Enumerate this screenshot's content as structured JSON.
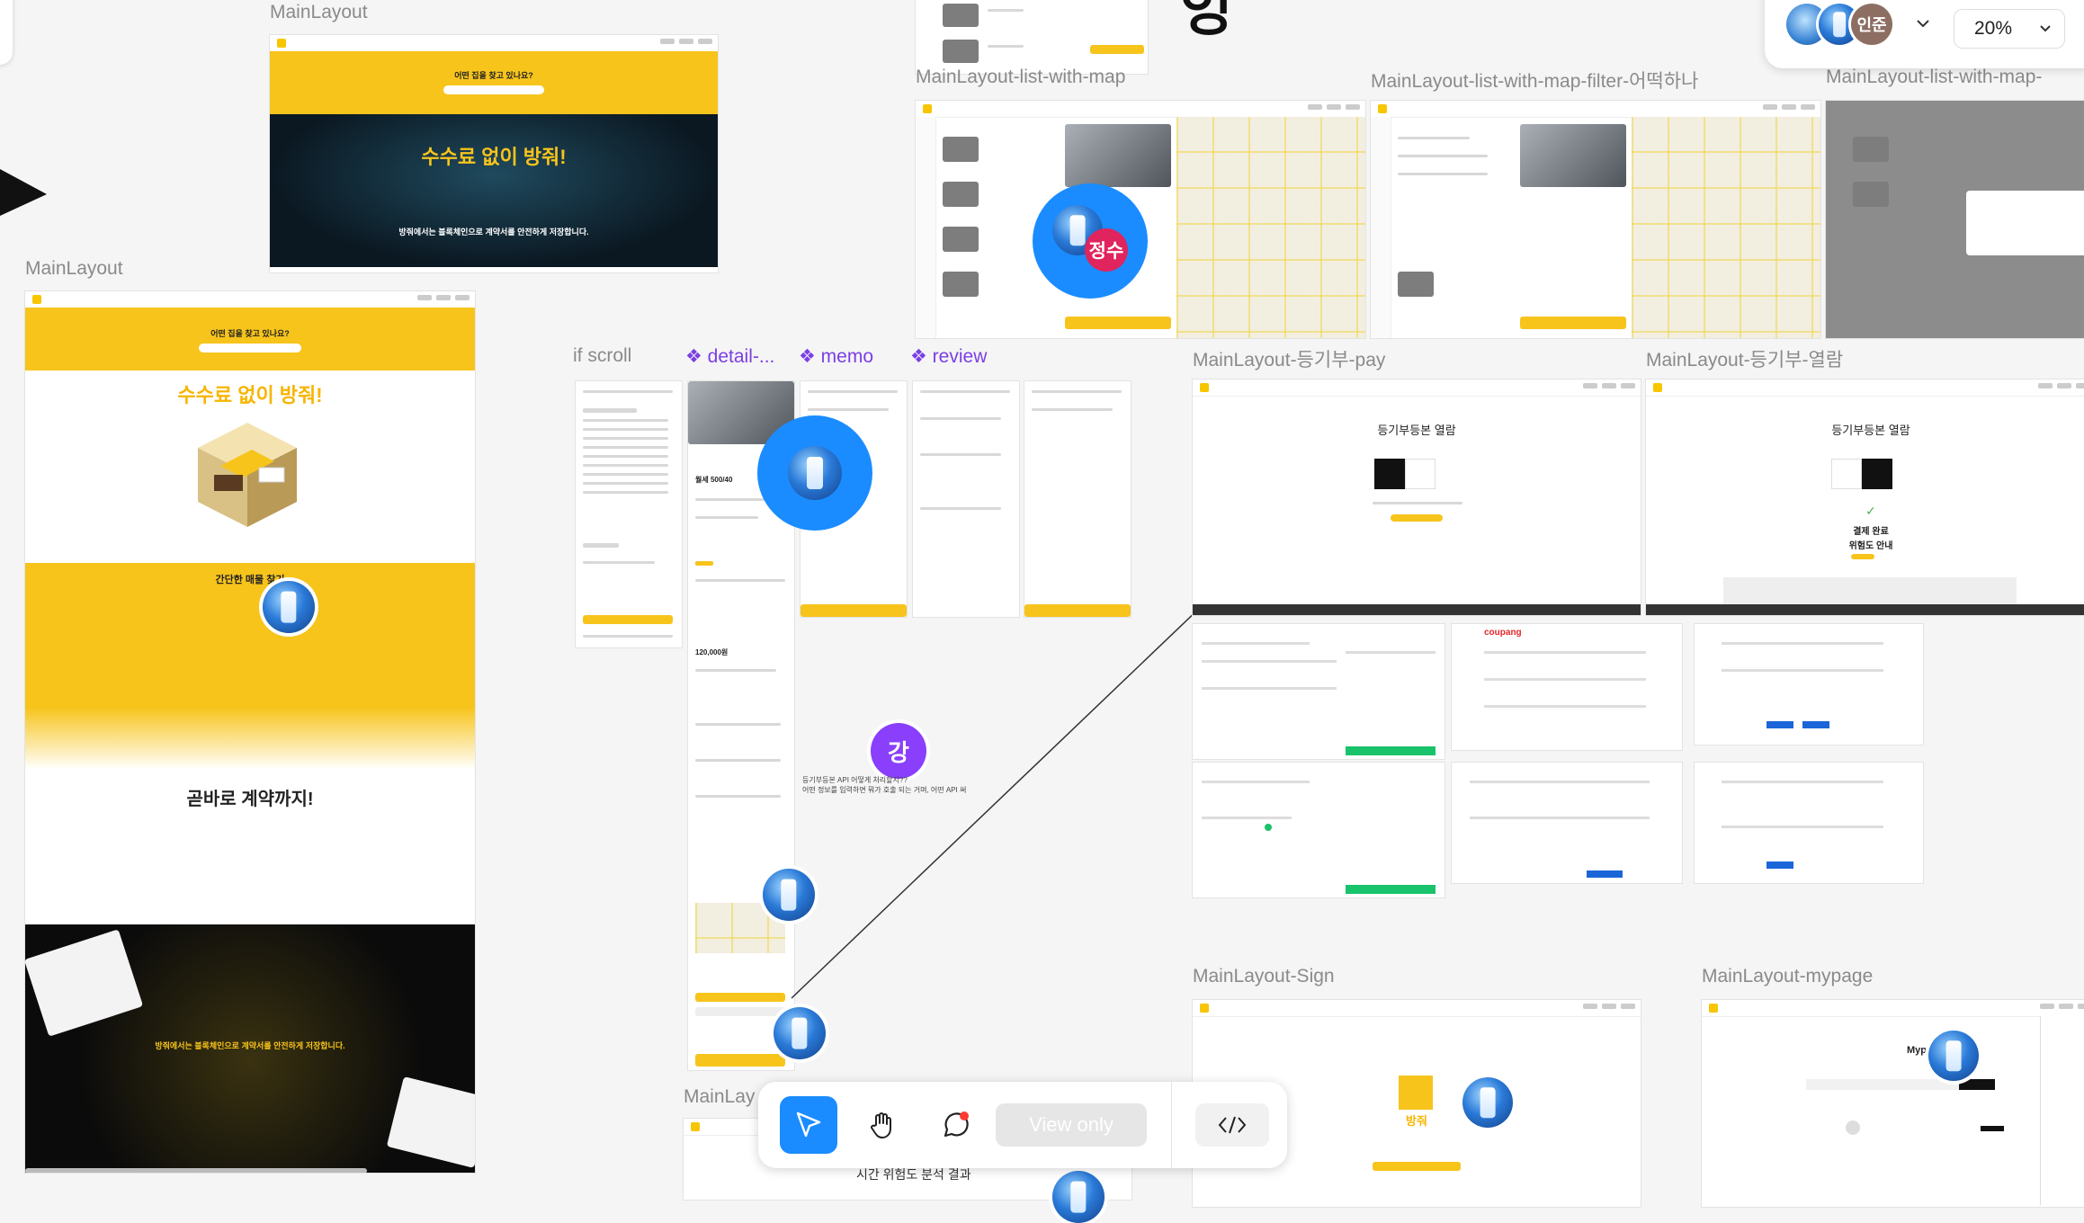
{
  "canvas": {
    "frame_labels": {
      "mainlayout_top": "MainLayout",
      "mainlayout_left": "MainLayout",
      "if_scroll": "if scroll",
      "list_with_map": "MainLayout-list-with-map",
      "list_with_map_filter": "MainLayout-list-with-map-filter-어떡하나",
      "list_with_map_cut": "MainLayout-list-with-map-",
      "registry_pay": "MainLayout-등기부-pay",
      "registry_view": "MainLayout-등기부-열람",
      "sign": "MainLayout-Sign",
      "mypage": "MainLayout-mypage",
      "mainlay_bottom": "MainLay"
    },
    "component_labels": {
      "detail": "detail-...",
      "memo": "memo",
      "review": "review"
    },
    "top_fragment": "엉"
  },
  "mock_main": {
    "search_prompt": "어떤 집을 찾고 있나요?",
    "hero_title": "수수료 없이 방줘!",
    "hero_sub": "방줘에서는 블록체인으로 계약서를 안전하게 저장합니다.",
    "section_find": "간단한 매물 찾기",
    "section_contract": "곧바로 계약까지!"
  },
  "mock_detail": {
    "price": "월세 500/40",
    "deposit": "120,000원"
  },
  "mock_registry": {
    "title": "등기부등본 열람",
    "done_title": "결제 완료",
    "done_sub": "위험도 안내"
  },
  "mock_sign": {
    "brand": "방줘"
  },
  "mock_mypage": {
    "title": "Myp"
  },
  "mock_other": {
    "coupang": "coupang",
    "bottom_text": "시간 위험도 분석 결과"
  },
  "comment": {
    "line1": "등기부등본 API 어떻게 처리할지??",
    "line2": "어떤 정보를 입력하면 뭐가 호출 되는 거며, 어떤 API 써"
  },
  "collaborators": {
    "jeongsu": "정수",
    "kang": "강",
    "injun": "인준"
  },
  "toolbar": {
    "view_only": "View only",
    "zoom": "20%"
  },
  "colors": {
    "brand_yellow": "#f7c41c",
    "accent_blue": "#1a8cff",
    "jeongsu_chip": "#e0245e",
    "kang_chip": "#8a3ffc",
    "component_purple": "#7b3fe4"
  }
}
